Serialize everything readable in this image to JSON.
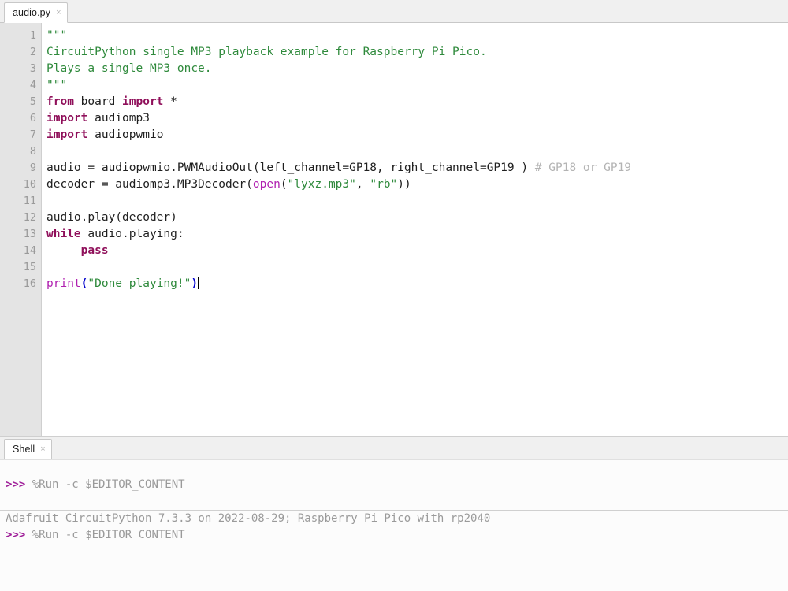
{
  "editor": {
    "tab": {
      "label": "audio.py",
      "close_icon": "close-icon",
      "close_glyph": "×"
    },
    "gutter_lines": [
      "1",
      "2",
      "3",
      "4",
      "5",
      "6",
      "7",
      "8",
      "9",
      "10",
      "11",
      "12",
      "13",
      "14",
      "15",
      "16"
    ],
    "cursor_line": 16,
    "code_plain": "\"\"\"\nCircuitPython single MP3 playback example for Raspberry Pi Pico.\nPlays a single MP3 once.\n\"\"\"\nfrom board import *\nimport audiomp3\nimport audiopwmio\n\naudio = audiopwmio.PWMAudioOut(left_channel=GP18, right_channel=GP19 ) # GP18 or GP19\ndecoder = audiomp3.MP3Decoder(open(\"lyxz.mp3\", \"rb\"))\n\naudio.play(decoder)\nwhile audio.playing:\n     pass\n\nprint(\"Done playing!\")",
    "lines": [
      {
        "n": 1,
        "tokens": [
          {
            "t": "doc",
            "v": "\"\"\""
          }
        ]
      },
      {
        "n": 2,
        "tokens": [
          {
            "t": "doc",
            "v": "CircuitPython single MP3 playback example for Raspberry Pi Pico."
          }
        ]
      },
      {
        "n": 3,
        "tokens": [
          {
            "t": "doc",
            "v": "Plays a single MP3 once."
          }
        ]
      },
      {
        "n": 4,
        "tokens": [
          {
            "t": "doc",
            "v": "\"\"\""
          }
        ]
      },
      {
        "n": 5,
        "tokens": [
          {
            "t": "kw",
            "v": "from"
          },
          {
            "t": "pl",
            "v": " board "
          },
          {
            "t": "kw",
            "v": "import"
          },
          {
            "t": "pl",
            "v": " *"
          }
        ]
      },
      {
        "n": 6,
        "tokens": [
          {
            "t": "kw",
            "v": "import"
          },
          {
            "t": "pl",
            "v": " audiomp3"
          }
        ]
      },
      {
        "n": 7,
        "tokens": [
          {
            "t": "kw",
            "v": "import"
          },
          {
            "t": "pl",
            "v": " audiopwmio"
          }
        ]
      },
      {
        "n": 8,
        "tokens": []
      },
      {
        "n": 9,
        "tokens": [
          {
            "t": "pl",
            "v": "audio = audiopwmio.PWMAudioOut(left_channel=GP18, right_channel=GP19 ) "
          },
          {
            "t": "cmt",
            "v": "# GP18 or GP19"
          }
        ]
      },
      {
        "n": 10,
        "tokens": [
          {
            "t": "pl",
            "v": "decoder = audiomp3.MP3Decoder("
          },
          {
            "t": "builtin",
            "v": "open"
          },
          {
            "t": "pl",
            "v": "("
          },
          {
            "t": "str",
            "v": "\"lyxz.mp3\""
          },
          {
            "t": "pl",
            "v": ", "
          },
          {
            "t": "str",
            "v": "\"rb\""
          },
          {
            "t": "pl",
            "v": "))"
          }
        ]
      },
      {
        "n": 11,
        "tokens": []
      },
      {
        "n": 12,
        "tokens": [
          {
            "t": "pl",
            "v": "audio.play(decoder)"
          }
        ]
      },
      {
        "n": 13,
        "tokens": [
          {
            "t": "kw",
            "v": "while"
          },
          {
            "t": "pl",
            "v": " audio.playing:"
          }
        ]
      },
      {
        "n": 14,
        "tokens": [
          {
            "t": "pl",
            "v": "     "
          },
          {
            "t": "kw",
            "v": "pass"
          }
        ]
      },
      {
        "n": 15,
        "tokens": []
      },
      {
        "n": 16,
        "tokens": [
          {
            "t": "builtin",
            "v": "print"
          },
          {
            "t": "brk",
            "v": "("
          },
          {
            "t": "str",
            "v": "\"Done playing!\""
          },
          {
            "t": "brk",
            "v": ")"
          }
        ],
        "caret": true
      }
    ]
  },
  "shell": {
    "tab": {
      "label": "Shell",
      "close_icon": "close-icon",
      "close_glyph": "×"
    },
    "prompt": ">>>",
    "rows": [
      {
        "kind": "spacer"
      },
      {
        "kind": "command",
        "prompt": ">>>",
        "text": "%Run -c $EDITOR_CONTENT"
      },
      {
        "kind": "spacer"
      },
      {
        "kind": "rule"
      },
      {
        "kind": "output",
        "text": "Adafruit CircuitPython 7.3.3 on 2022-08-29; Raspberry Pi Pico with rp2040"
      },
      {
        "kind": "command",
        "prompt": ">>>",
        "text": "%Run -c $EDITOR_CONTENT"
      }
    ]
  },
  "theme": {
    "keyword": "#8f0f5a",
    "string": "#2f8a3c",
    "builtin": "#b020b0",
    "comment": "#b3b3b3",
    "bracket": "#0000cc",
    "prompt": "#a0219a",
    "gutter_bg": "#e4e4e4",
    "gutter_fg": "#9a9a9a",
    "editor_bg": "#ffffff",
    "shell_bg": "#fcfcfc",
    "tabstrip_bg": "#f0f0f0"
  }
}
